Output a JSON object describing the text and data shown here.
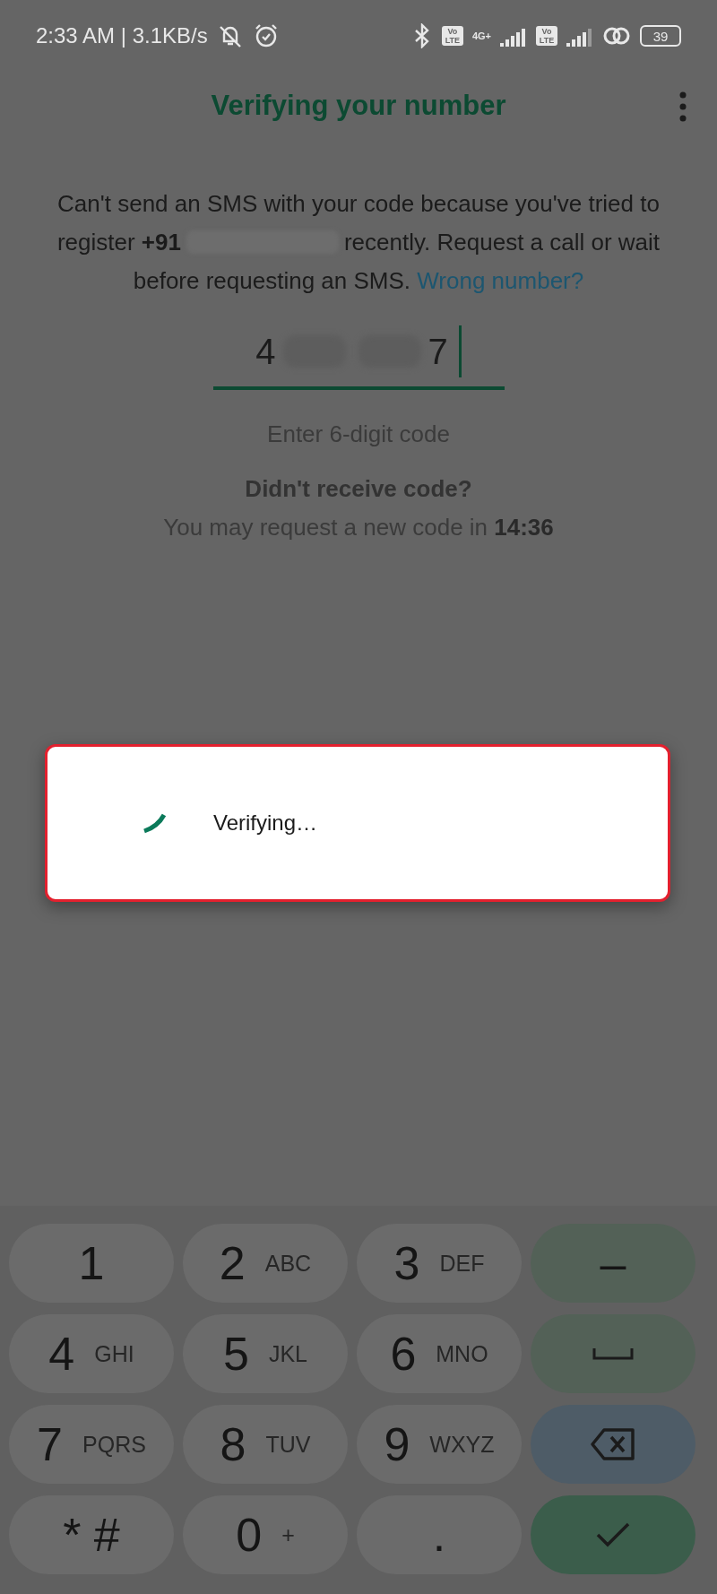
{
  "status_bar": {
    "time": "2:33 AM | 3.1KB/s",
    "network_type": "4G+",
    "volte_badges": [
      "Vo LTE",
      "Vo LTE"
    ],
    "battery": "39"
  },
  "app_bar": {
    "title": "Verifying your number"
  },
  "message": {
    "before": "Can't send an SMS with your code because you've tried to register **+91**",
    "after": "recently. Request a call or wait before requesting an SMS.",
    "link": "Wrong number?"
  },
  "code_field": {
    "first_digit": "4",
    "last_digit": "7",
    "hint": "Enter 6-digit code"
  },
  "resend": {
    "title": "Didn't receive code?",
    "text": "You may request a new code in **14:36**"
  },
  "dialog": {
    "text": "Verifying…"
  },
  "keyboard": {
    "keys": [
      {
        "kind": "digit",
        "label": "1"
      },
      {
        "kind": "digit",
        "label": "2",
        "letters": "ABC"
      },
      {
        "kind": "digit",
        "label": "3",
        "letters": "DEF"
      },
      {
        "kind": "action",
        "label": "–"
      },
      {
        "kind": "digit",
        "label": "4",
        "letters": "GHI"
      },
      {
        "kind": "digit",
        "label": "5",
        "letters": "JKL"
      },
      {
        "kind": "digit",
        "label": "6",
        "letters": "MNO"
      },
      {
        "kind": "space"
      },
      {
        "kind": "digit",
        "label": "7",
        "letters": "PQRS"
      },
      {
        "kind": "digit",
        "label": "8",
        "letters": "TUV"
      },
      {
        "kind": "digit",
        "label": "9",
        "letters": "WXYZ"
      },
      {
        "kind": "backspace"
      },
      {
        "kind": "digit",
        "label": "* #"
      },
      {
        "kind": "digit",
        "label": "0",
        "letters": "+"
      },
      {
        "kind": "digit",
        "label": "."
      },
      {
        "kind": "done"
      }
    ]
  }
}
